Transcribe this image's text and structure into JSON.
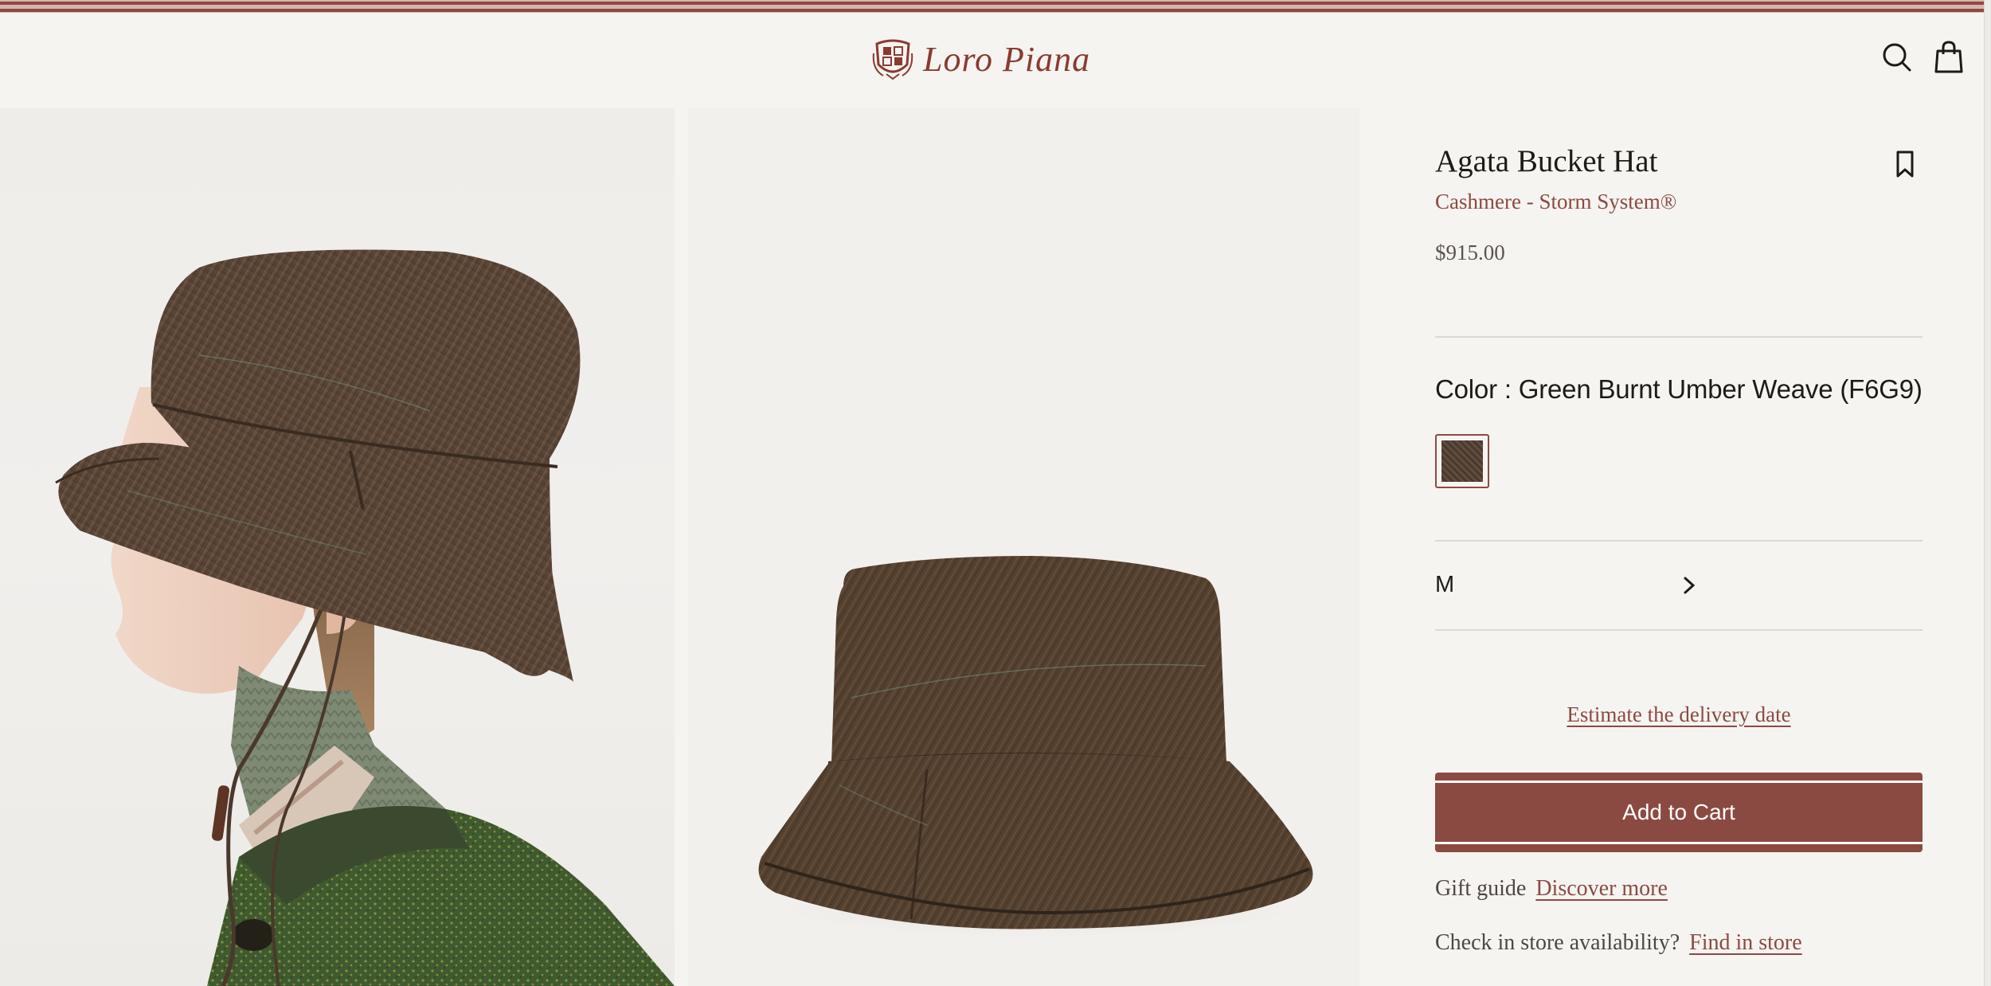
{
  "header": {
    "brand": "Loro Piana",
    "search_icon": "search-icon",
    "bag_icon": "shopping-bag-icon"
  },
  "gallery": {
    "images": [
      {
        "name": "model-wearing-hat"
      },
      {
        "name": "hat-product-shot"
      }
    ]
  },
  "product": {
    "title": "Agata Bucket Hat",
    "subtitle": "Cashmere - Storm System®",
    "price": "$915.00",
    "color_label": "Color : Green Burnt Umber Weave (F6G9)",
    "size_value": "M",
    "delivery_link": "Estimate the delivery date",
    "add_to_cart": "Add to Cart",
    "gift_label": "Gift guide",
    "gift_link": "Discover more",
    "store_label": "Check in store availability?",
    "store_link": "Find in store"
  },
  "colors": {
    "accent": "#8b4a41",
    "background": "#f6f4f1",
    "text": "#1e1a18"
  }
}
